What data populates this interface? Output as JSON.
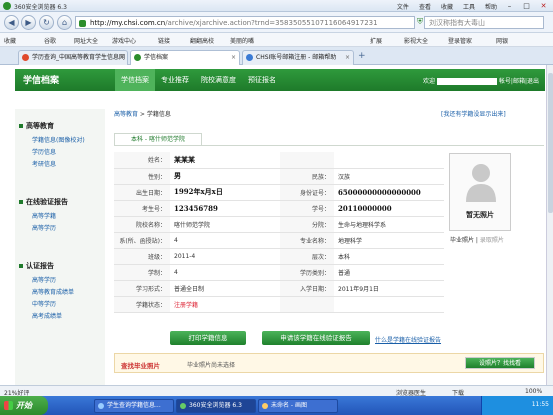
{
  "browser": {
    "title": "360安全浏览器 6.3",
    "menus": [
      "文件",
      "查看",
      "收藏",
      "工具",
      "帮助"
    ],
    "url_host": "http://my.chsi.com.cn",
    "url_path": "/archive/xjarchive.action?trnd=35835055107116064917231",
    "search_placeholder": "刘汉称指有大毒山",
    "favorites": [
      "收藏",
      "谷歌",
      "网址大全",
      "游戏中心",
      "链接",
      "翻翻高校",
      "美丽的嘴",
      "扩展",
      "影视大全",
      "登录管家",
      "网银"
    ],
    "tabs": [
      {
        "label": "学历查询_中国高等教育学生信息网"
      },
      {
        "label": "学信档案"
      },
      {
        "label": "CHSI账号邮箱注册 - 邮箱帮助"
      }
    ],
    "status_left": "21%好评",
    "status_right": [
      "浏览器医生",
      "下载",
      "100%"
    ]
  },
  "site": {
    "brand": "学信档案",
    "nav": [
      "学信档案",
      "专业推荐",
      "院校满意度",
      "预征报名"
    ],
    "user_prefix": "欢迎",
    "user_links": [
      "帐号",
      "邮箱",
      "退出"
    ]
  },
  "sidebar": {
    "sections": [
      {
        "title": "高等教育",
        "items": [
          "学籍信息(图像校对)",
          "学历信息",
          "考研信息"
        ]
      },
      {
        "title": "在线验证报告",
        "items": [
          "高等学籍",
          "高等学历"
        ]
      },
      {
        "title": "认证报告",
        "items": [
          "高等学历",
          "高等教育成绩单",
          "中等学历",
          "高考成绩单"
        ]
      }
    ]
  },
  "breadcrumb": {
    "link": "高等教育",
    "sep": " > ",
    "current": "学籍信息"
  },
  "report_link": "[我还有学籍没显示出来]",
  "section_tab": "本科 - 喀什师范学院",
  "info": {
    "name_label": "姓名：",
    "name": "某某某",
    "gender_label": "性别：",
    "gender": "男",
    "ethnic_label": "民族：",
    "ethnic": "汉族",
    "birth_label": "出生日期：",
    "birth": "1992年x月x日",
    "idno_label": "身份证号：",
    "idno": "65000000000000000",
    "examno_label": "考生号：",
    "examno": "123456789",
    "studentno_label": "学号：",
    "studentno": "20110000000",
    "school_label": "院校名称：",
    "school": "喀什师范学院",
    "branch_label": "分院：",
    "branch": "生命与地理科学系",
    "dept_label": "系(所、函授站)：",
    "dept": "4",
    "major_label": "专业名称：",
    "major": "地理科学",
    "class_label": "班级：",
    "class": "2011-4",
    "level_label": "层次：",
    "level": "本科",
    "duration_label": "学制：",
    "duration": "4",
    "type_label": "学历类别：",
    "type": "普通",
    "form_label": "学习形式：",
    "form": "普通全日制",
    "entry_label": "入学日期：",
    "entry": "2011年9月1日",
    "status_label": "学籍状态：",
    "status": "注册学籍"
  },
  "photo": {
    "placeholder": "暂无照片",
    "caption": "毕业照片",
    "caption2": "录取照片"
  },
  "buttons": {
    "print": "打印学籍信息",
    "verify": "申请该学籍在线验证报告",
    "verify_link": "什么是学籍在线验证报告"
  },
  "bottom": {
    "title": "查找毕业照片",
    "text": "毕业照片尚未选择",
    "button": "设照片？找找看"
  },
  "taskbar": {
    "start": "开始",
    "tasks": [
      "学生查询学籍信息...",
      "360安全浏览器 6.3",
      "未命名 - 画图"
    ],
    "clock": "11:55"
  }
}
